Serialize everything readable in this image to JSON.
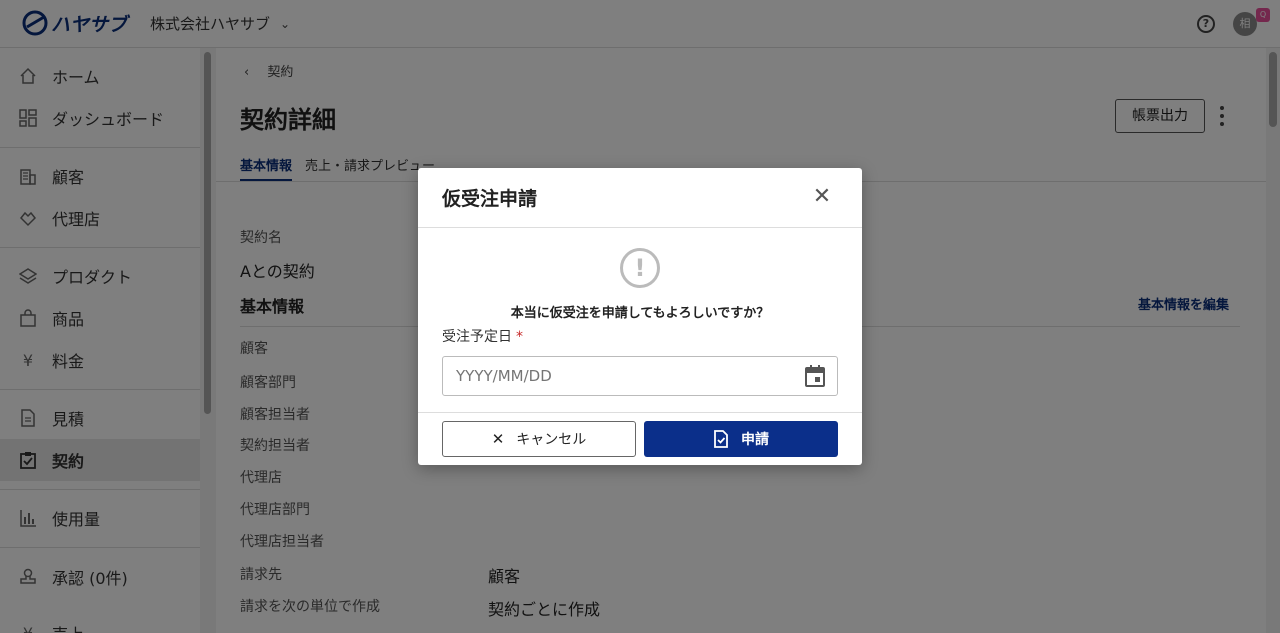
{
  "header": {
    "logo_text": "ハヤサブ",
    "company": "株式会社ハヤサブ",
    "help_icon": "question-circle-icon",
    "avatar_initial": "相",
    "avatar_badge": "Q"
  },
  "sidebar": {
    "items": [
      {
        "label": "ホーム",
        "icon": "home-icon"
      },
      {
        "label": "ダッシュボード",
        "icon": "dashboard-icon"
      },
      {
        "label": "顧客",
        "icon": "building-icon"
      },
      {
        "label": "代理店",
        "icon": "handshake-icon"
      },
      {
        "label": "プロダクト",
        "icon": "layers-icon"
      },
      {
        "label": "商品",
        "icon": "bag-icon"
      },
      {
        "label": "料金",
        "icon": "yen-icon"
      },
      {
        "label": "見積",
        "icon": "document-icon"
      },
      {
        "label": "契約",
        "icon": "clipboard-check-icon"
      },
      {
        "label": "使用量",
        "icon": "bar-chart-icon"
      },
      {
        "label": "承認 (0件)",
        "icon": "stamp-icon"
      },
      {
        "label": "売上",
        "icon": "sales-icon"
      }
    ]
  },
  "main": {
    "breadcrumb": "契約",
    "title": "契約詳細",
    "export_button": "帳票出力",
    "tabs": [
      "基本情報",
      "売上・請求プレビュー"
    ],
    "contract_name_label": "契約名",
    "contract_name_value": "Aとの契約",
    "section_title": "基本情報",
    "edit_link": "基本情報を編集",
    "fields": [
      {
        "label": "顧客",
        "value": ""
      },
      {
        "label": "顧客部門",
        "value": ""
      },
      {
        "label": "顧客担当者",
        "value": ""
      },
      {
        "label": "契約担当者",
        "value": ""
      },
      {
        "label": "代理店",
        "value": ""
      },
      {
        "label": "代理店部門",
        "value": ""
      },
      {
        "label": "代理店担当者",
        "value": ""
      },
      {
        "label": "請求先",
        "value": "顧客"
      },
      {
        "label": "請求を次の単位で作成",
        "value": "契約ごとに作成"
      }
    ]
  },
  "modal": {
    "title": "仮受注申請",
    "message": "本当に仮受注を申請してもよろしいですか？",
    "date_label": "受注予定日",
    "required_mark": "*",
    "date_placeholder": "YYYY/MM/DD",
    "cancel_label": "キャンセル",
    "apply_label": "申請"
  }
}
